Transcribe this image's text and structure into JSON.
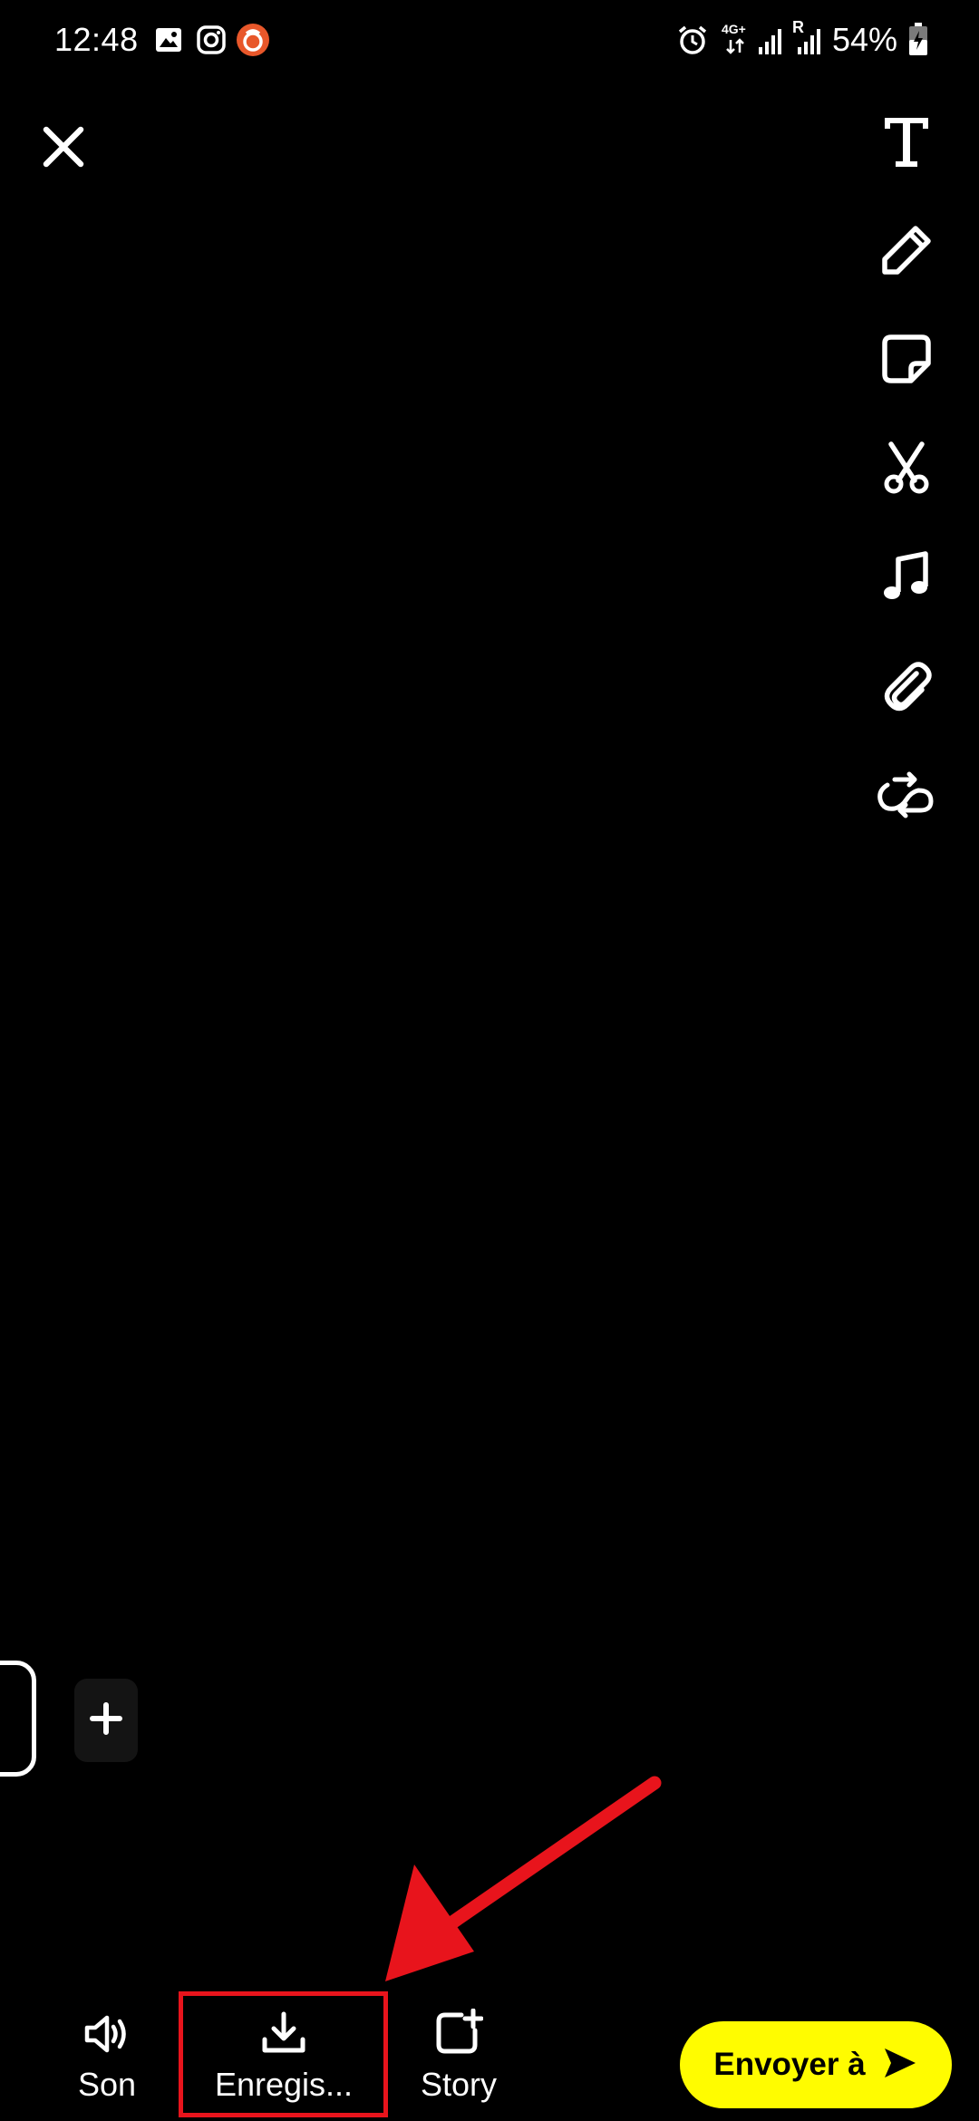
{
  "status_bar": {
    "time": "12:48",
    "network": "4G+",
    "roaming_indicator": "R",
    "battery": "54%",
    "icons": [
      "gallery-icon",
      "instagram-icon",
      "app-notification-icon",
      "alarm-icon",
      "signal-icon",
      "signal-roaming-icon",
      "battery-charging-icon"
    ]
  },
  "toolbar": {
    "close_icon": "close-icon",
    "tools": [
      "text-icon",
      "pencil-icon",
      "sticker-icon",
      "scissors-icon",
      "music-icon",
      "paperclip-icon",
      "loop-icon"
    ]
  },
  "frames": {
    "add_icon": "plus-icon"
  },
  "bottom_bar": {
    "sound_label": "Son",
    "save_label": "Enregis...",
    "story_label": "Story",
    "send_label": "Envoyer à"
  },
  "colors": {
    "background": "#000000",
    "send_button": "#fffc00",
    "annotation": "#e8141c"
  }
}
